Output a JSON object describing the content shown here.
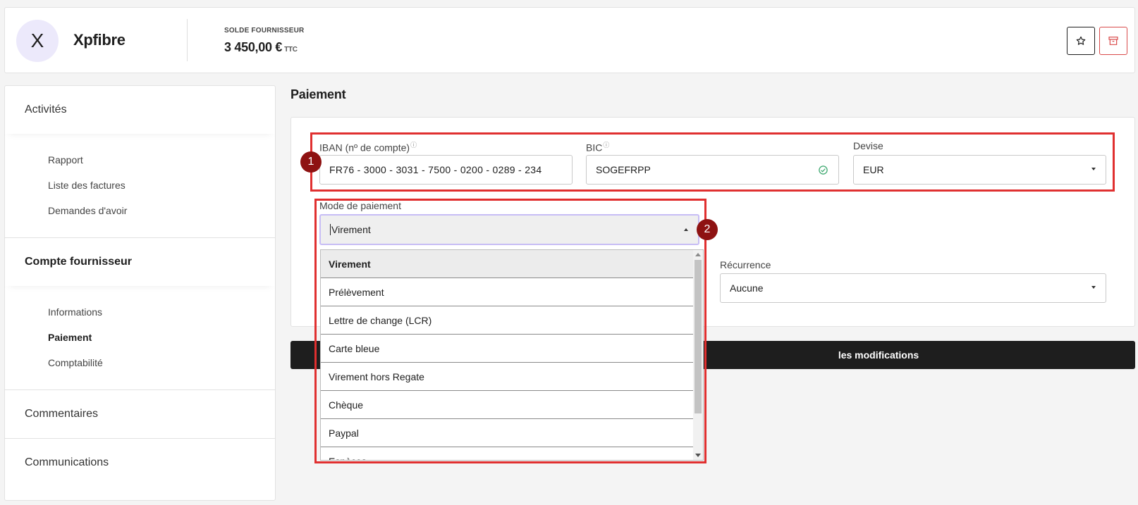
{
  "header": {
    "avatar_letter": "X",
    "supplier_name": "Xpfibre",
    "balance_label": "SOLDE FOURNISSEUR",
    "balance_value": "3 450,00 €",
    "balance_suffix": "TTC",
    "star_icon": "star-icon",
    "archive_icon": "archive-icon",
    "accent_red": "#d94a4a"
  },
  "sidebar": {
    "sections": [
      {
        "label": "Activités",
        "items": [
          "Rapport",
          "Liste des factures",
          "Demandes d'avoir"
        ]
      },
      {
        "label": "Compte fournisseur",
        "items": [
          "Informations",
          "Paiement",
          "Comptabilité"
        ]
      },
      {
        "label": "Commentaires"
      },
      {
        "label": "Communications"
      }
    ],
    "active_item": "Paiement"
  },
  "main": {
    "title": "Paiement",
    "iban": {
      "label": "IBAN (nº de compte)",
      "value": "FR76 - 3000 - 3031 - 7500 - 0200 - 0289 - 234"
    },
    "bic": {
      "label": "BIC",
      "value": "SOGEFRPP",
      "status_icon": "check-circle-icon"
    },
    "devise": {
      "label": "Devise",
      "value": "EUR"
    },
    "mode": {
      "label": "Mode de paiement",
      "value": "Virement"
    },
    "recurrence": {
      "label": "Récurrence",
      "value": "Aucune"
    },
    "save_label": "les modifications",
    "focus_color": "#c7bdf5"
  },
  "dropdown": {
    "options": [
      "Virement",
      "Prélèvement",
      "Lettre de change (LCR)",
      "Carte bleue",
      "Virement hors Regate",
      "Chèque",
      "Paypal",
      "Espèces"
    ],
    "selected": "Virement"
  },
  "annotations": {
    "badge_1": "1",
    "badge_2": "2",
    "color": "#e03030"
  }
}
